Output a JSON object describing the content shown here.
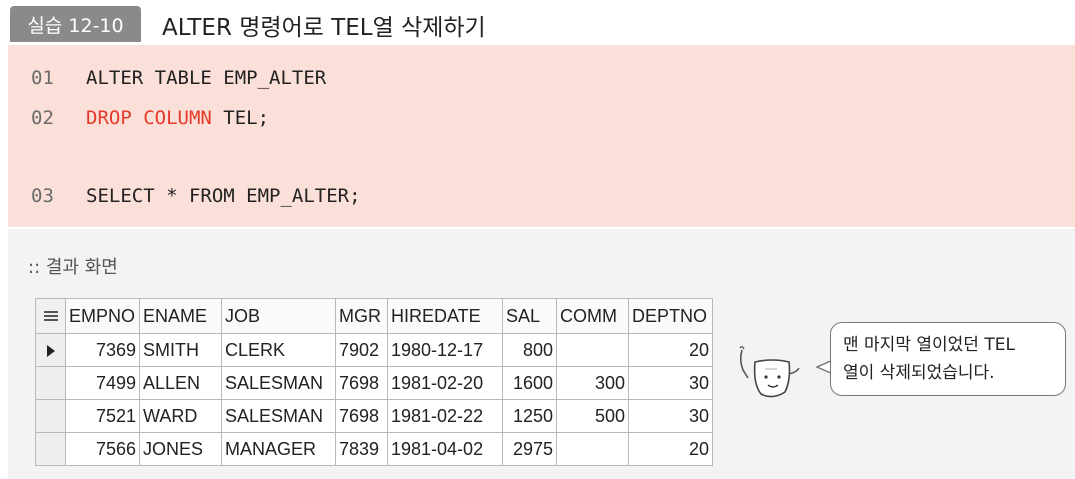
{
  "header": {
    "badge": "실습 12-10",
    "title": "ALTER 명령어로 TEL열 삭제하기"
  },
  "code": {
    "lines": [
      {
        "no": "01",
        "keyword": "",
        "text": "ALTER TABLE EMP_ALTER"
      },
      {
        "no": "02",
        "keyword": "DROP COLUMN",
        "text": " TEL;"
      },
      {
        "no": "03",
        "keyword": "",
        "text": "SELECT * FROM EMP_ALTER;"
      }
    ]
  },
  "result": {
    "label": ":: 결과 화면",
    "columns": [
      "EMPNO",
      "ENAME",
      "JOB",
      "MGR",
      "HIREDATE",
      "SAL",
      "COMM",
      "DEPTNO"
    ],
    "rows": [
      [
        "7369",
        "SMITH",
        "CLERK",
        "7902",
        "1980-12-17",
        "800",
        "",
        "20"
      ],
      [
        "7499",
        "ALLEN",
        "SALESMAN",
        "7698",
        "1981-02-20",
        "1600",
        "300",
        "30"
      ],
      [
        "7521",
        "WARD",
        "SALESMAN",
        "7698",
        "1981-02-22",
        "1250",
        "500",
        "30"
      ],
      [
        "7566",
        "JONES",
        "MANAGER",
        "7839",
        "1981-04-02",
        "2975",
        "",
        "20"
      ]
    ]
  },
  "bubble": {
    "line1": "맨 마지막 열이었던 TEL",
    "line2": "열이 삭제되었습니다."
  },
  "icons": [
    "grid-menu-icon",
    "current-row-arrow-icon",
    "character-illustration"
  ]
}
